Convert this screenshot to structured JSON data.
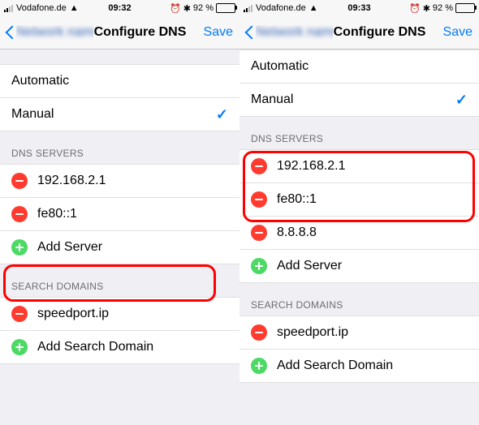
{
  "left": {
    "status": {
      "carrier": "Vodafone.de",
      "time": "09:32",
      "battery_pct": "92 %"
    },
    "nav": {
      "back_label": "Network name",
      "title": "Configure DNS",
      "save": "Save"
    },
    "mode": {
      "automatic": "Automatic",
      "manual": "Manual",
      "selected": "manual"
    },
    "dns_header": "DNS SERVERS",
    "dns_servers": [
      "192.168.2.1",
      "fe80::1"
    ],
    "add_server": "Add Server",
    "search_header": "SEARCH DOMAINS",
    "search_domains": [
      "speedport.ip"
    ],
    "add_search": "Add Search Domain"
  },
  "right": {
    "status": {
      "carrier": "Vodafone.de",
      "time": "09:33",
      "battery_pct": "92 %"
    },
    "nav": {
      "back_label": "Network name",
      "title": "Configure DNS",
      "save": "Save"
    },
    "mode": {
      "automatic": "Automatic",
      "manual": "Manual",
      "selected": "manual"
    },
    "dns_header": "DNS SERVERS",
    "dns_servers": [
      "192.168.2.1",
      "fe80::1",
      "8.8.8.8"
    ],
    "add_server": "Add Server",
    "search_header": "SEARCH DOMAINS",
    "search_domains": [
      "speedport.ip"
    ],
    "add_search": "Add Search Domain"
  }
}
